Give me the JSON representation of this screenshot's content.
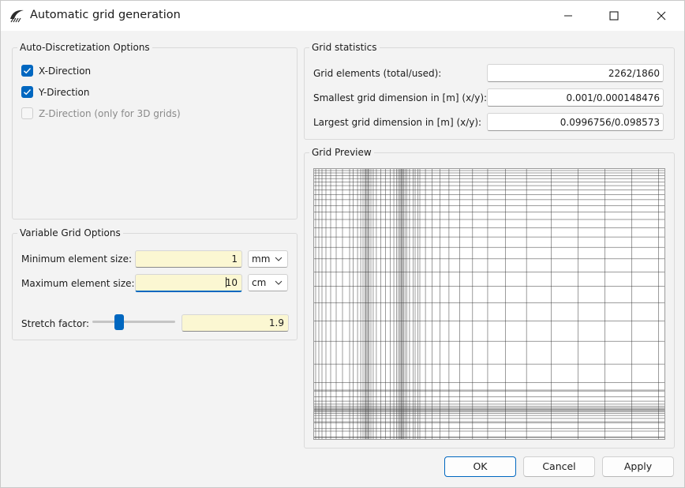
{
  "window": {
    "title": "Automatic grid generation"
  },
  "auto_discretization": {
    "title": "Auto-Discretization Options",
    "options": [
      {
        "label": "X-Direction",
        "checked": true,
        "enabled": true
      },
      {
        "label": "Y-Direction",
        "checked": true,
        "enabled": true
      },
      {
        "label": "Z-Direction (only for 3D grids)",
        "checked": false,
        "enabled": false
      }
    ]
  },
  "variable_grid": {
    "title": "Variable Grid Options",
    "min_label": "Minimum element size:",
    "min_value": "1",
    "min_unit": "mm",
    "max_label": "Maximum element size:",
    "max_value": "10",
    "max_unit": "cm",
    "stretch_label": "Stretch factor:",
    "stretch_value": "1.9"
  },
  "statistics": {
    "title": "Grid statistics",
    "rows": [
      {
        "label": "Grid elements (total/used):",
        "value": "2262/1860"
      },
      {
        "label": "Smallest grid dimension in [m] (x/y):",
        "value": "0.001/0.000148476"
      },
      {
        "label": "Largest grid dimension in [m] (x/y):",
        "value": "0.0996756/0.098573"
      }
    ]
  },
  "preview": {
    "title": "Grid Preview"
  },
  "buttons": {
    "ok": "OK",
    "cancel": "Cancel",
    "apply": "Apply"
  },
  "colors": {
    "accent": "#0067c0",
    "input_highlight": "#fbf7d2",
    "window_bg": "#f3f3f3"
  },
  "icons": {
    "app": "app-logo-icon",
    "minimize": "minimize-icon",
    "maximize": "maximize-icon",
    "close": "close-icon",
    "check": "check-icon",
    "dropdown": "chevron-down-icon"
  }
}
